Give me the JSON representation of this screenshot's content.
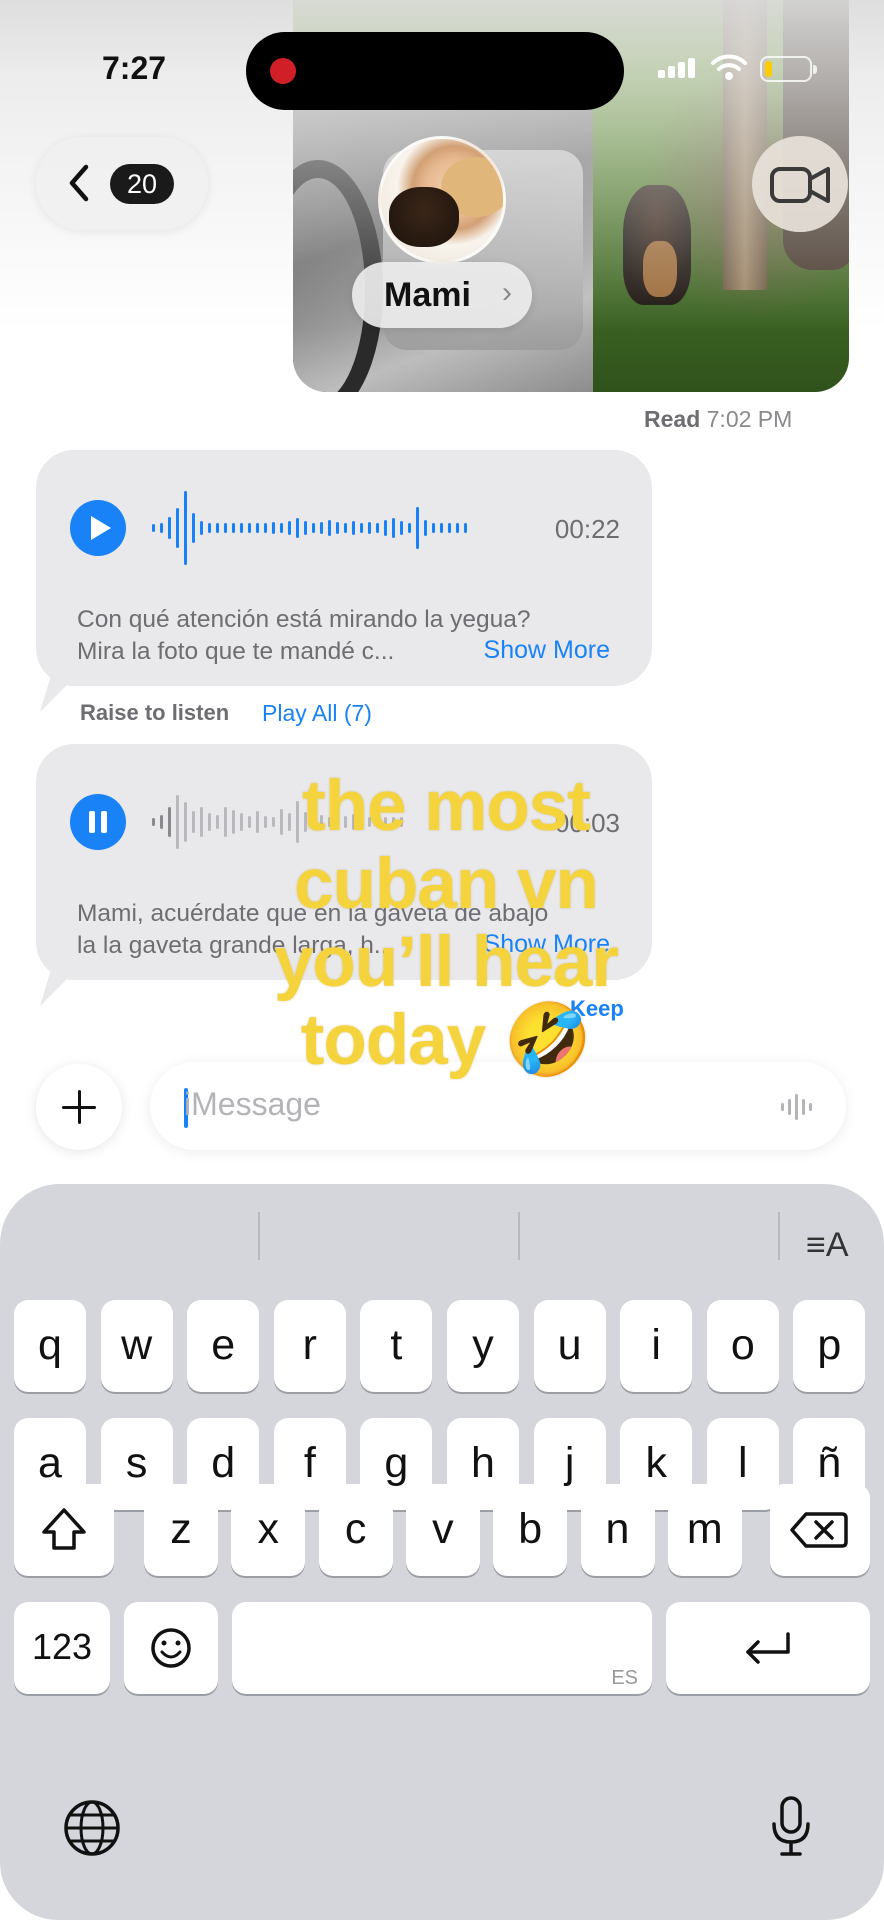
{
  "status": {
    "time": "7:27"
  },
  "header": {
    "unread_count": "20",
    "contact_name": "Mami"
  },
  "read_receipt": {
    "label": "Read",
    "time": "7:02 PM"
  },
  "messages": [
    {
      "duration": "00:22",
      "text_line1": "Con qué atención está mirando la yegua?",
      "text_line2": "Mira la foto que te mandé c...",
      "show_more": "Show More",
      "state": "play"
    },
    {
      "duration": "00:03",
      "text_line1": "Mami, acuérdate que en la gaveta de abajo",
      "text_line2": "la la gaveta grande larga, h...",
      "show_more": "Show More",
      "state": "pause"
    }
  ],
  "audio_controls": {
    "raise": "Raise to listen",
    "play_all": "Play All (7)",
    "keep": "Keep"
  },
  "compose": {
    "placeholder": "iMessage"
  },
  "overlay_caption": {
    "line1": "the most",
    "line2": "cuban vn",
    "line3": "you’ll hear",
    "line4": "today 🤣"
  },
  "keyboard": {
    "row1": [
      "q",
      "w",
      "e",
      "r",
      "t",
      "y",
      "u",
      "i",
      "o",
      "p"
    ],
    "row2": [
      "a",
      "s",
      "d",
      "f",
      "g",
      "h",
      "j",
      "k",
      "l",
      "ñ"
    ],
    "row3": [
      "z",
      "x",
      "c",
      "v",
      "b",
      "n",
      "m"
    ],
    "numbers_key": "123",
    "language": "ES",
    "format_icon": "≡A"
  },
  "colors": {
    "accent": "#1a82f7",
    "caption": "#f5d33c",
    "bubble": "#e9e9eb",
    "keyboard": "#d4d6dc"
  }
}
